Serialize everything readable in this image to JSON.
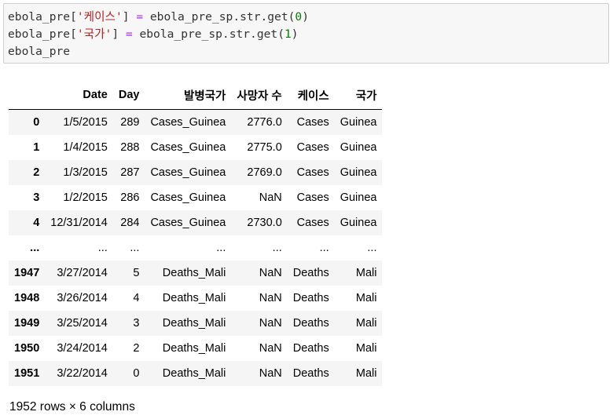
{
  "code_cell": {
    "lines": [
      [
        {
          "t": "ebola_pre[",
          "c": "plain"
        },
        {
          "t": "'케이스'",
          "c": "str"
        },
        {
          "t": "] ",
          "c": "plain"
        },
        {
          "t": "=",
          "c": "op"
        },
        {
          "t": " ebola_pre_sp.str.get(",
          "c": "plain"
        },
        {
          "t": "0",
          "c": "num"
        },
        {
          "t": ")",
          "c": "plain"
        }
      ],
      [
        {
          "t": "ebola_pre[",
          "c": "plain"
        },
        {
          "t": "'국가'",
          "c": "str"
        },
        {
          "t": "] ",
          "c": "plain"
        },
        {
          "t": "=",
          "c": "op"
        },
        {
          "t": " ebola_pre_sp.str.get(",
          "c": "plain"
        },
        {
          "t": "1",
          "c": "num"
        },
        {
          "t": ")",
          "c": "plain"
        }
      ],
      [
        {
          "t": "ebola_pre",
          "c": "plain"
        }
      ]
    ]
  },
  "table": {
    "columns": [
      "",
      "Date",
      "Day",
      "발병국가",
      "사망자 수",
      "케이스",
      "국가"
    ],
    "rows": [
      [
        "0",
        "1/5/2015",
        "289",
        "Cases_Guinea",
        "2776.0",
        "Cases",
        "Guinea"
      ],
      [
        "1",
        "1/4/2015",
        "288",
        "Cases_Guinea",
        "2775.0",
        "Cases",
        "Guinea"
      ],
      [
        "2",
        "1/3/2015",
        "287",
        "Cases_Guinea",
        "2769.0",
        "Cases",
        "Guinea"
      ],
      [
        "3",
        "1/2/2015",
        "286",
        "Cases_Guinea",
        "NaN",
        "Cases",
        "Guinea"
      ],
      [
        "4",
        "12/31/2014",
        "284",
        "Cases_Guinea",
        "2730.0",
        "Cases",
        "Guinea"
      ],
      [
        "...",
        "...",
        "...",
        "...",
        "...",
        "...",
        "..."
      ],
      [
        "1947",
        "3/27/2014",
        "5",
        "Deaths_Mali",
        "NaN",
        "Deaths",
        "Mali"
      ],
      [
        "1948",
        "3/26/2014",
        "4",
        "Deaths_Mali",
        "NaN",
        "Deaths",
        "Mali"
      ],
      [
        "1949",
        "3/25/2014",
        "3",
        "Deaths_Mali",
        "NaN",
        "Deaths",
        "Mali"
      ],
      [
        "1950",
        "3/24/2014",
        "2",
        "Deaths_Mali",
        "NaN",
        "Deaths",
        "Mali"
      ],
      [
        "1951",
        "3/22/2014",
        "0",
        "Deaths_Mali",
        "NaN",
        "Deaths",
        "Mali"
      ]
    ]
  },
  "shape_note": "1952 rows × 6 columns",
  "colors": {
    "code_background": "#f7f7f7",
    "code_border": "#cfcfcf",
    "string": "#ba2121",
    "operator": "#aa22ff",
    "number": "#008000",
    "stripe": "#f5f5f5"
  }
}
